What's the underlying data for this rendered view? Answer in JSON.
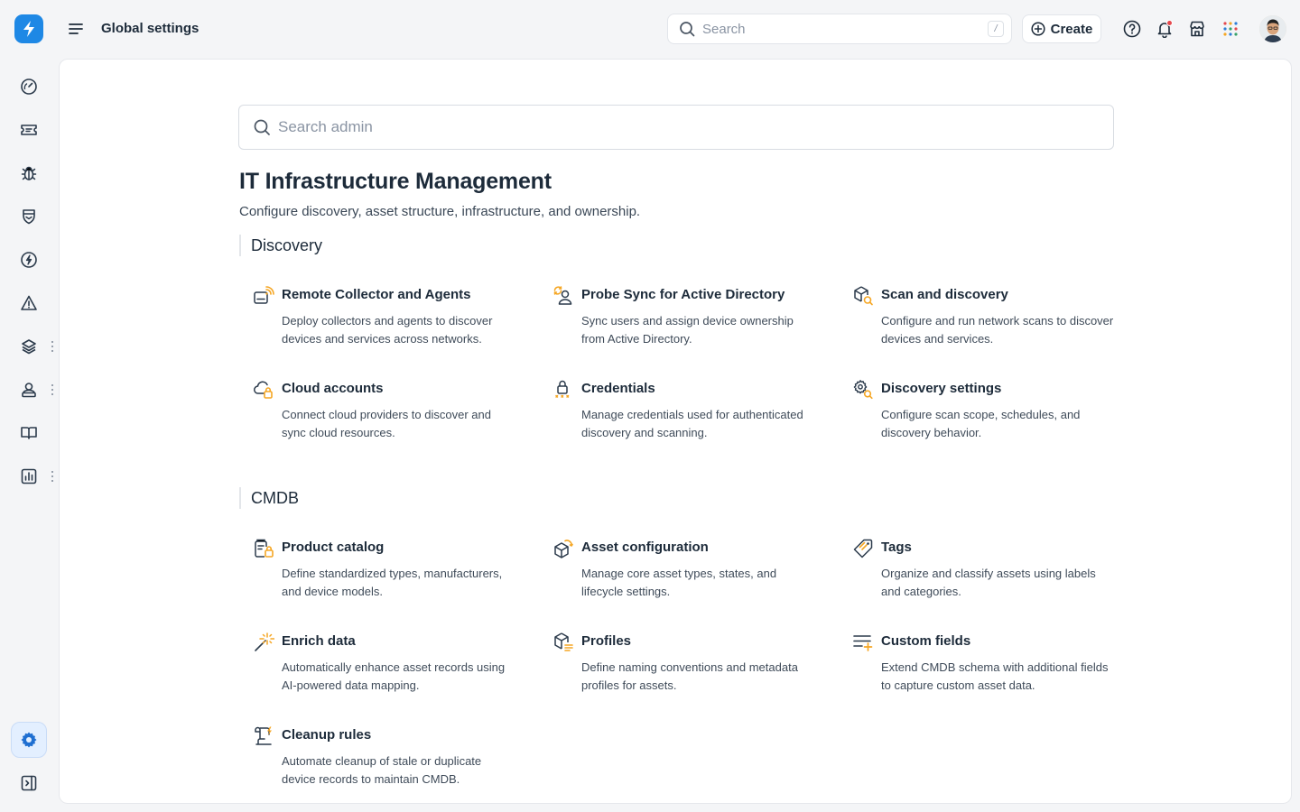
{
  "header": {
    "title": "Global settings",
    "search_placeholder": "Search",
    "search_shortcut": "/",
    "create_label": "Create"
  },
  "admin_search": {
    "placeholder": "Search admin"
  },
  "section": {
    "title": "IT Infrastructure Management",
    "description": "Configure discovery, asset structure, infrastructure, and ownership."
  },
  "groups": [
    {
      "title": "Discovery",
      "items": [
        {
          "title": "Remote Collector and Agents",
          "description": "Deploy collectors and agents to discover devices and services across networks.",
          "icon": "remote-collector-icon"
        },
        {
          "title": "Probe Sync for Active Directory",
          "description": "Sync users and assign device ownership from Active Directory.",
          "icon": "probe-sync-icon"
        },
        {
          "title": "Scan and discovery",
          "description": "Configure and run network scans to discover devices and services.",
          "icon": "scan-discovery-icon"
        },
        {
          "title": "Cloud accounts",
          "description": "Connect cloud providers to discover and sync cloud resources.",
          "icon": "cloud-lock-icon"
        },
        {
          "title": "Credentials",
          "description": "Manage credentials used for authenticated discovery and scanning.",
          "icon": "credentials-lock-icon"
        },
        {
          "title": "Discovery settings",
          "description": "Configure scan scope, schedules, and discovery behavior.",
          "icon": "discovery-settings-icon"
        }
      ]
    },
    {
      "title": "CMDB",
      "items": [
        {
          "title": "Product catalog",
          "description": "Define standardized types, manufacturers, and device models.",
          "icon": "product-catalog-icon"
        },
        {
          "title": "Asset configuration",
          "description": "Manage core asset types, states, and lifecycle settings.",
          "icon": "asset-configuration-icon"
        },
        {
          "title": "Tags",
          "description": "Organize and classify assets using labels and categories.",
          "icon": "tag-icon"
        },
        {
          "title": "Enrich data",
          "description": "Automatically enhance asset records using AI-powered data mapping.",
          "icon": "magic-wand-icon"
        },
        {
          "title": "Profiles",
          "description": "Define naming conventions and metadata profiles for assets.",
          "icon": "profiles-icon"
        },
        {
          "title": "Custom fields",
          "description": "Extend CMDB schema with additional fields to capture custom asset data.",
          "icon": "custom-fields-icon"
        },
        {
          "title": "Cleanup rules",
          "description": "Automate cleanup of stale or duplicate device records to maintain CMDB.",
          "icon": "cleanup-rules-icon"
        }
      ]
    }
  ],
  "colors": {
    "accent": "#1e88e5",
    "icon_accent": "#f5a623",
    "notification_dot": "#e5484d"
  }
}
